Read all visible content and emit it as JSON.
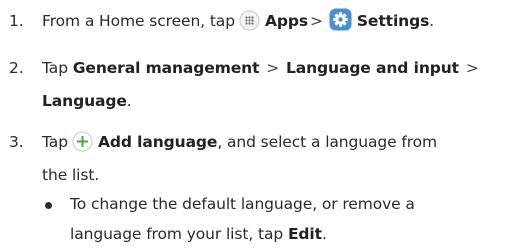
{
  "steps": [
    {
      "num": "1.",
      "t1": "From a Home screen, tap",
      "apps": "Apps",
      "sep": ">",
      "settings": "Settings",
      "dot": "."
    },
    {
      "num": "2.",
      "tap": "Tap",
      "general": "General management",
      "sep1": ">",
      "language_input": "Language and input",
      "sep2": ">",
      "language": "Language",
      "dot": "."
    },
    {
      "num": "3.",
      "tap": "Tap",
      "add_language": "Add language",
      "rest1": ", and select a language from",
      "rest2": "the list."
    }
  ],
  "bullet": {
    "line1": "To change the default language, or remove a",
    "line2": "language from your list, tap",
    "edit": "Edit",
    "dot": "."
  },
  "icons": {
    "apps": "apps-grid-icon",
    "settings": "settings-gear-icon",
    "add": "add-plus-icon"
  },
  "colors": {
    "settings_blue": "#4a8ed8",
    "add_green": "#3fae3a"
  }
}
